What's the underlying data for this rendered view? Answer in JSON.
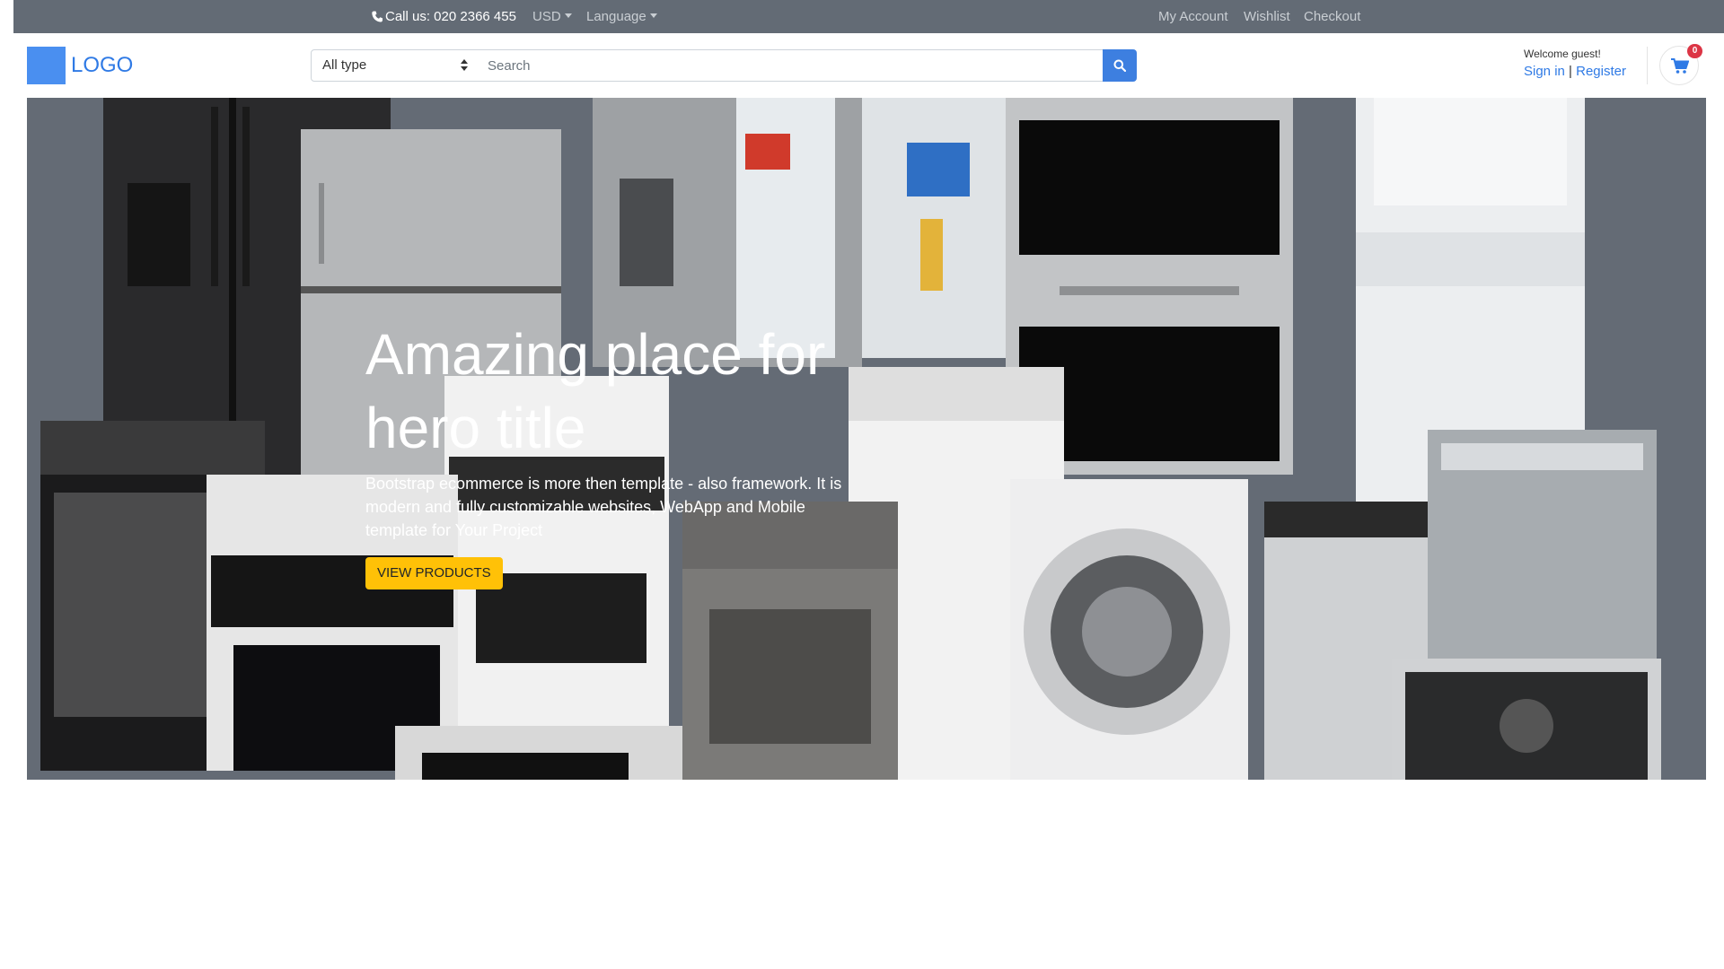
{
  "topbar": {
    "phone_icon": "phone-icon",
    "call_text": "Call us: 020 2366 455",
    "currency": "USD",
    "language": "Language",
    "links": {
      "account": "My Account",
      "wishlist": "Wishlist",
      "checkout": "Checkout"
    }
  },
  "header": {
    "logo_text": "LOGO",
    "search": {
      "type_selected": "All type",
      "placeholder": "Search",
      "button_icon": "search-icon"
    },
    "user": {
      "welcome": "Welcome guest!",
      "sign_in": "Sign in",
      "separator": "|",
      "register": "Register"
    },
    "cart": {
      "icon": "cart-icon",
      "count": "0"
    }
  },
  "hero": {
    "title": "Amazing place for hero title",
    "text": "Bootstrap ecommerce is more then template - also framework. It is modern and fully customizable websites, WebApp and Mobile template for Your Project",
    "button_label": "VIEW PRODUCTS"
  },
  "colors": {
    "topbar_bg": "#636b75",
    "primary": "#3d7fe0",
    "link": "#2f7ae5",
    "accent_button": "#ffc107",
    "badge": "#dc3545",
    "hero_bg": "#646b75"
  }
}
